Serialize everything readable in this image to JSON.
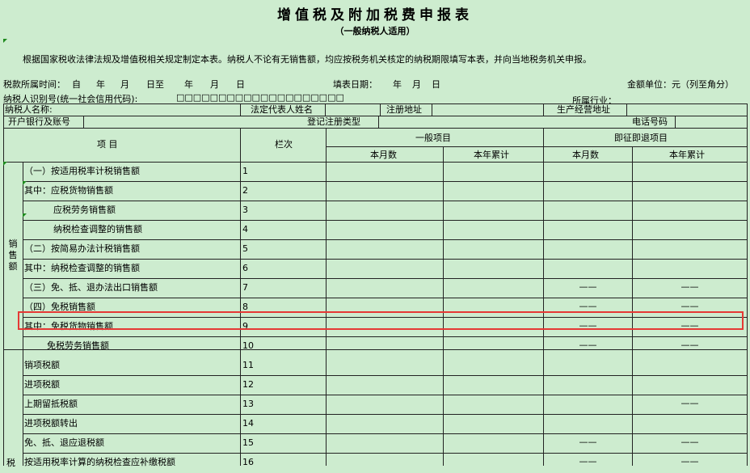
{
  "header": {
    "title": "增值税及附加税费申报表",
    "subtitle": "（一般纳税人适用）",
    "note": "根据国家税收法律法规及增值税相关规定制定本表。纳税人不论有无销售额，均应按税务机关核定的纳税期限填写本表，并向当地税务机关申报。"
  },
  "meta": {
    "period_label": "税款所属时间：",
    "period_from": "自",
    "year1": "年",
    "month1": "月",
    "day_to": "日至",
    "year2": "年",
    "month2": "月",
    "day2": "日",
    "fill_date_label": "填表日期：",
    "fill_year": "年",
    "fill_month": "月",
    "fill_day": "日",
    "unit": "金额单位：元（列至角分）",
    "taxpayer_id_label": "纳税人识别号(统一社会信用代码):",
    "taxpayer_id_boxes": "□□□□□□□□□□□□□□□□□□□□",
    "industry_label": "所属行业："
  },
  "info": {
    "name_label": "纳税人名称:",
    "legal_rep_label": "法定代表人姓名",
    "reg_address_label": "注册地址",
    "biz_address_label": "生产经营地址",
    "bank_label": "开户银行及账号",
    "reg_type_label": "登记注册类型",
    "phone_label": "电话号码"
  },
  "columns": {
    "item": "项    目",
    "line_no": "栏次",
    "general": "一般项目",
    "immediate": "即征即退项目",
    "this_month": "本月数",
    "ytd": "本年累计"
  },
  "group_label": "销售额",
  "rows": [
    {
      "label": "（一）按适用税率计税销售额",
      "no": "1"
    },
    {
      "label": "其中：应税货物销售额",
      "no": "2"
    },
    {
      "label": "应税劳务销售额",
      "no": "3"
    },
    {
      "label": "纳税检查调整的销售额",
      "no": "4"
    },
    {
      "label": "（二）按简易办法计税销售额",
      "no": "5"
    },
    {
      "label": "其中：纳税检查调整的销售额",
      "no": "6"
    },
    {
      "label": "（三）免、抵、退办法出口销售额",
      "no": "7"
    },
    {
      "label": "（四）免税销售额",
      "no": "8"
    },
    {
      "label": "其中：免税货物销售额",
      "no": "9"
    },
    {
      "label": "免税劳务销售额",
      "no": "10"
    },
    {
      "label": "销项税额",
      "no": "11"
    },
    {
      "label": "进项税额",
      "no": "12"
    },
    {
      "label": "上期留抵税额",
      "no": "13"
    },
    {
      "label": "进项税额转出",
      "no": "14"
    },
    {
      "label": "免、抵、退应退税额",
      "no": "15"
    },
    {
      "label": "按适用税率计算的纳税检查应补缴税额",
      "no": "16"
    }
  ],
  "dash": "——",
  "partial_group_label": "税"
}
